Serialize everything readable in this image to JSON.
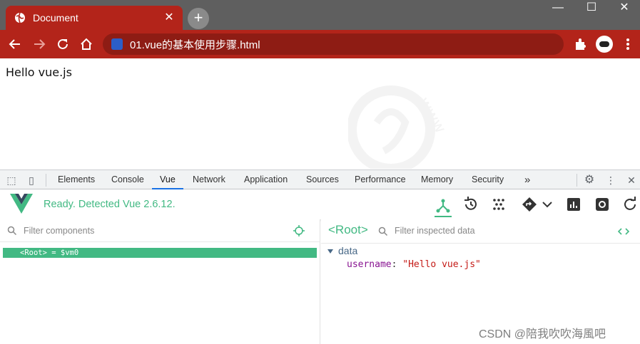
{
  "browser": {
    "tab_title": "Document",
    "url": "01.vue的基本使用步骤.html"
  },
  "page": {
    "content_text": "Hello vue.js"
  },
  "devtools": {
    "tabs": [
      "Elements",
      "Console",
      "Vue",
      "Network",
      "Application",
      "Sources",
      "Performance",
      "Memory",
      "Security"
    ],
    "active_tab": "Vue",
    "more_label": "»"
  },
  "vue": {
    "status": "Ready. Detected Vue 2.6.12.",
    "filter_components_placeholder": "Filter components",
    "root_row": "<Root> = $vm0",
    "root_label": "<Root>",
    "filter_data_placeholder": "Filter inspected data",
    "section": "data",
    "prop_key": "username",
    "prop_colon": ":",
    "prop_value": "\"Hello vue.js\"",
    "accent": "#42b983"
  },
  "watermark_text": "CSDN @陪我吹吹海風吧",
  "colors": {
    "chrome_red": "#b3241a",
    "vue_green": "#42b983"
  }
}
